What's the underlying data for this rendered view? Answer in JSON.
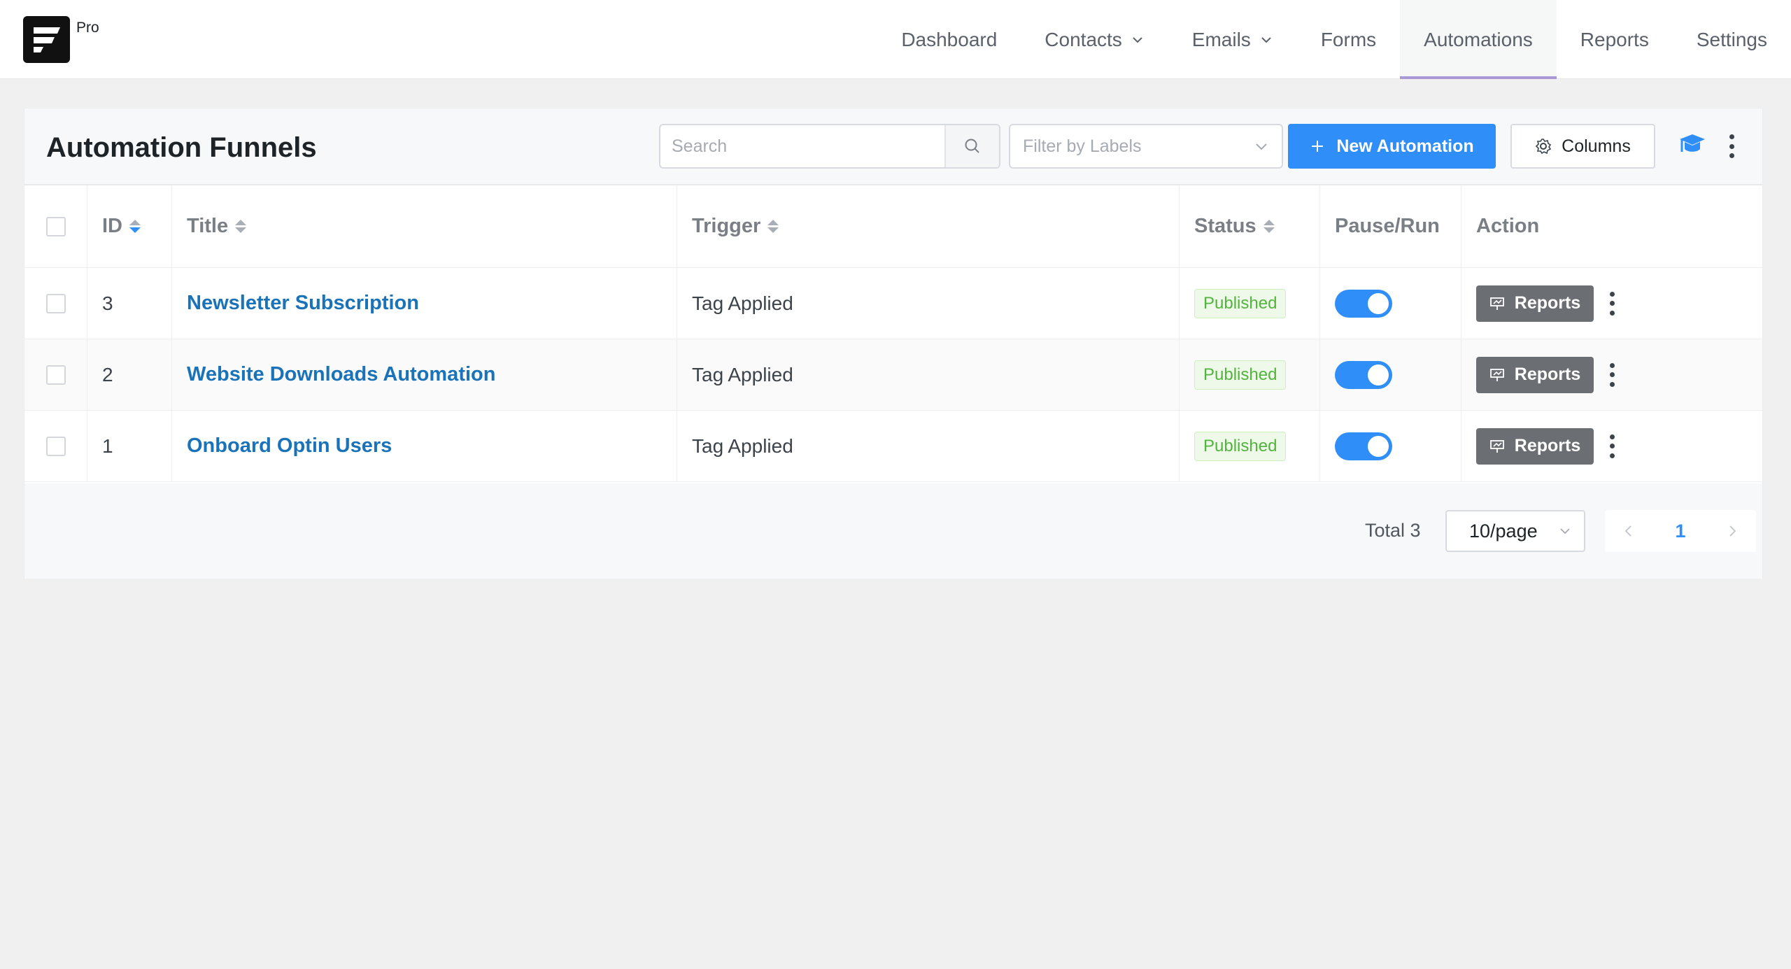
{
  "brand": {
    "pro_label": "Pro"
  },
  "nav": {
    "items": [
      {
        "label": "Dashboard"
      },
      {
        "label": "Contacts"
      },
      {
        "label": "Emails"
      },
      {
        "label": "Forms"
      },
      {
        "label": "Automations"
      },
      {
        "label": "Reports"
      },
      {
        "label": "Settings"
      }
    ],
    "active": "Automations"
  },
  "page": {
    "title": "Automation Funnels",
    "search_placeholder": "Search",
    "filter_placeholder": "Filter by Labels",
    "new_button": "New Automation",
    "columns_button": "Columns"
  },
  "table": {
    "headers": {
      "id": "ID",
      "title": "Title",
      "trigger": "Trigger",
      "status": "Status",
      "pause_run": "Pause/Run",
      "action": "Action"
    },
    "rows": [
      {
        "id": "3",
        "title": "Newsletter Subscription",
        "trigger": "Tag Applied",
        "status": "Published",
        "running": true,
        "action_label": "Reports"
      },
      {
        "id": "2",
        "title": "Website Downloads Automation",
        "trigger": "Tag Applied",
        "status": "Published",
        "running": true,
        "action_label": "Reports"
      },
      {
        "id": "1",
        "title": "Onboard Optin Users",
        "trigger": "Tag Applied",
        "status": "Published",
        "running": true,
        "action_label": "Reports"
      }
    ]
  },
  "pagination": {
    "total_text": "Total 3",
    "per_page": "10/page",
    "current_page": "1"
  },
  "colors": {
    "primary": "#2f8ef7",
    "link": "#1a73b8",
    "published_text": "#52b43c",
    "nav_active_underline": "#a99ad6"
  },
  "icons": {
    "search": "search-icon",
    "filter": "chevron-down-icon",
    "new": "plus-icon",
    "columns": "gear-icon",
    "help": "graduation-cap-icon",
    "more": "kebab-icon",
    "reports": "presentation-chart-icon"
  }
}
